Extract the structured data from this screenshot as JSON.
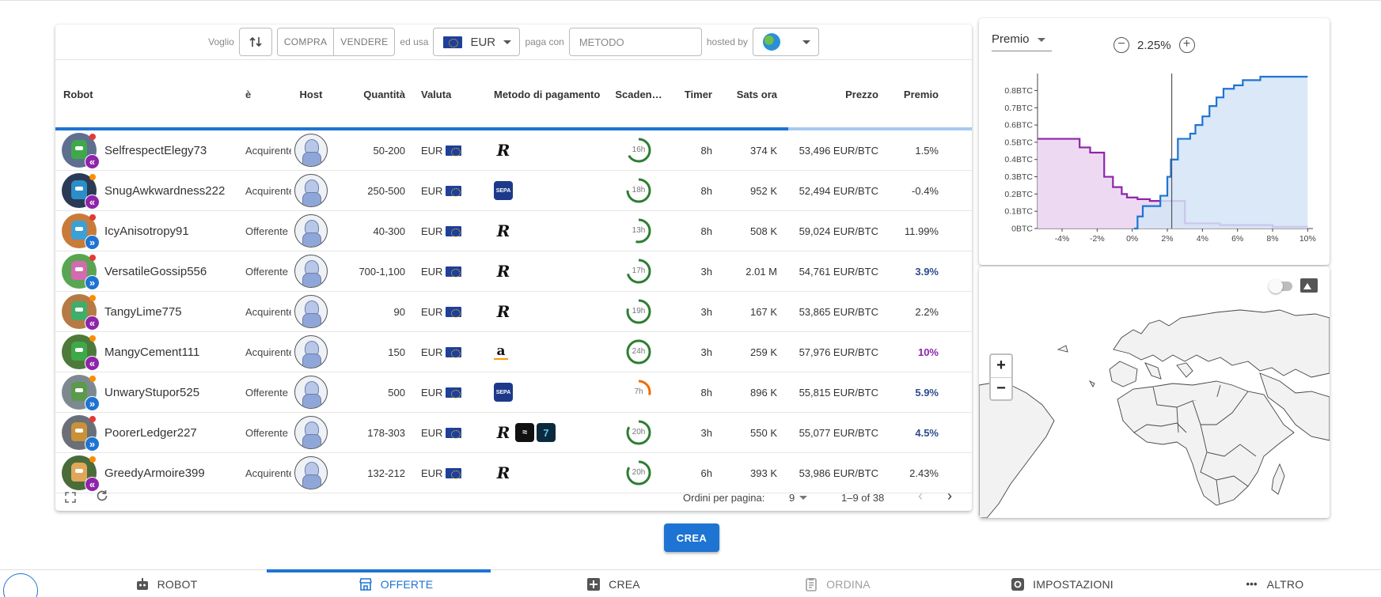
{
  "filter": {
    "voglio": "Voglio",
    "compra": "COMPRA",
    "vendere": "VENDERE",
    "ed_usa": "ed usa",
    "currency": "EUR",
    "paga_con": "paga con",
    "method_placeholder": "METODO",
    "hosted_by": "hosted by"
  },
  "table": {
    "headers": [
      "Robot",
      "è",
      "Host",
      "Quantità",
      "Valuta",
      "Metodo di pagamento",
      "Scaden…",
      "Timer",
      "Sats ora",
      "Prezzo",
      "Premio"
    ],
    "loading_progress": 0.8,
    "rows": [
      {
        "nick": "SelfrespectElegy73",
        "is": "Acquirente",
        "side": "buy",
        "status": "#e53935",
        "avatar": "#5f6f8f",
        "head": "#3fa84a",
        "qty": "50-200",
        "cur": "EUR",
        "methods": [
          "revolut"
        ],
        "exp": "16h",
        "exp_frac": 0.67,
        "exp_color": "#2e7d32",
        "timer": "8h",
        "sats": "374 K",
        "price": "53,496 EUR/BTC",
        "premium": "1.5%",
        "prem_style": "normal"
      },
      {
        "nick": "SnugAwkwardness222",
        "is": "Acquirente",
        "side": "buy",
        "status": "#fb8c00",
        "avatar": "#2b3a55",
        "head": "#2a8fc9",
        "qty": "250-500",
        "cur": "EUR",
        "methods": [
          "sepa"
        ],
        "exp": "18h",
        "exp_frac": 0.75,
        "exp_color": "#2e7d32",
        "timer": "8h",
        "sats": "952 K",
        "price": "52,494 EUR/BTC",
        "premium": "-0.4%",
        "prem_style": "normal"
      },
      {
        "nick": "IcyAnisotropy91",
        "is": "Offerente",
        "side": "sell",
        "status": "#e53935",
        "avatar": "#c97b3a",
        "head": "#3aa0d8",
        "qty": "40-300",
        "cur": "EUR",
        "methods": [
          "revolut"
        ],
        "exp": "13h",
        "exp_frac": 0.54,
        "exp_color": "#2e7d32",
        "timer": "8h",
        "sats": "508 K",
        "price": "59,024 EUR/BTC",
        "premium": "11.99%",
        "prem_style": "normal"
      },
      {
        "nick": "VersatileGossip556",
        "is": "Offerente",
        "side": "sell",
        "status": "#e53935",
        "avatar": "#5aa552",
        "head": "#d46bb0",
        "qty": "700-1,100",
        "cur": "EUR",
        "methods": [
          "revolut"
        ],
        "exp": "17h",
        "exp_frac": 0.71,
        "exp_color": "#2e7d32",
        "timer": "3h",
        "sats": "2.01 M",
        "price": "54,761 EUR/BTC",
        "premium": "3.9%",
        "prem_style": "sell"
      },
      {
        "nick": "TangyLime775",
        "is": "Acquirente",
        "side": "buy",
        "status": "#fb8c00",
        "avatar": "#b57a45",
        "head": "#3fae6a",
        "qty": "90",
        "cur": "EUR",
        "methods": [
          "revolut"
        ],
        "exp": "19h",
        "exp_frac": 0.79,
        "exp_color": "#2e7d32",
        "timer": "3h",
        "sats": "167 K",
        "price": "53,865 EUR/BTC",
        "premium": "2.2%",
        "prem_style": "normal"
      },
      {
        "nick": "MangyCement111",
        "is": "Acquirente",
        "side": "buy",
        "status": "#fb8c00",
        "avatar": "#4d7a3a",
        "head": "#3fa84a",
        "qty": "150",
        "cur": "EUR",
        "methods": [
          "amazon"
        ],
        "exp": "24h",
        "exp_frac": 1.0,
        "exp_color": "#2e7d32",
        "timer": "3h",
        "sats": "259 K",
        "price": "57,976 EUR/BTC",
        "premium": "10%",
        "prem_style": "buy"
      },
      {
        "nick": "UnwaryStupor525",
        "is": "Offerente",
        "side": "sell",
        "status": "#fb8c00",
        "avatar": "#7c8a8f",
        "head": "#5a9a4a",
        "qty": "500",
        "cur": "EUR",
        "methods": [
          "sepa"
        ],
        "exp": "7h",
        "exp_frac": 0.29,
        "exp_color": "#ef6c00",
        "timer": "8h",
        "sats": "896 K",
        "price": "55,815 EUR/BTC",
        "premium": "5.9%",
        "prem_style": "sell"
      },
      {
        "nick": "PoorerLedger227",
        "is": "Offerente",
        "side": "sell",
        "status": "#e53935",
        "avatar": "#6a6f78",
        "head": "#c9913a",
        "qty": "178-303",
        "cur": "EUR",
        "methods": [
          "revolut",
          "dark",
          "teal"
        ],
        "exp": "20h",
        "exp_frac": 0.83,
        "exp_color": "#2e7d32",
        "timer": "3h",
        "sats": "550 K",
        "price": "55,077 EUR/BTC",
        "premium": "4.5%",
        "prem_style": "sell"
      },
      {
        "nick": "GreedyArmoire399",
        "is": "Acquirente",
        "side": "buy",
        "status": "#fb8c00",
        "avatar": "#4a6b3a",
        "head": "#e0a65a",
        "qty": "132-212",
        "cur": "EUR",
        "methods": [
          "revolut"
        ],
        "exp": "20h",
        "exp_frac": 0.83,
        "exp_color": "#2e7d32",
        "timer": "6h",
        "sats": "393 K",
        "price": "53,986 EUR/BTC",
        "premium": "2.43%",
        "prem_style": "normal"
      }
    ],
    "method_glyphs": {
      "revolut": "R",
      "sepa": "SEPA",
      "amazon": "a",
      "dark": "≈",
      "teal": "7"
    },
    "footer": {
      "rows_per_page_label": "Ordini per pagina:",
      "rows_per_page": "9",
      "range": "1–9 of 38"
    }
  },
  "depth_chart": {
    "selector": "Premio",
    "zoom_value": "2.25%"
  },
  "chart_data": {
    "type": "area",
    "xlabel": "",
    "ylabel": "",
    "x_ticks": [
      "-4%",
      "-2%",
      "0%",
      "2%",
      "4%",
      "6%",
      "8%",
      "10%"
    ],
    "y_ticks": [
      "0BTC",
      "0.1BTC",
      "0.2BTC",
      "0.3BTC",
      "0.4BTC",
      "0.5BTC",
      "0.6BTC",
      "0.7BTC",
      "0.8BTC"
    ],
    "xlim": [
      -5.4,
      10.3
    ],
    "ylim": [
      0,
      0.88
    ],
    "center_line": 2.25,
    "series": [
      {
        "color": "#8e24aa",
        "fill": "#ead3f0",
        "x": [
          -5.4,
          -3.0,
          -3.0,
          -2.4,
          -2.4,
          -1.6,
          -1.6,
          -1.1,
          -1.1,
          -0.6,
          -0.6,
          -0.3,
          -0.3,
          0.3,
          0.3,
          1.0,
          1.0,
          3.0,
          3.0,
          5.0,
          5.0,
          8.0,
          8.0,
          10.0
        ],
        "y": [
          0.52,
          0.52,
          0.47,
          0.47,
          0.44,
          0.44,
          0.3,
          0.3,
          0.24,
          0.24,
          0.2,
          0.2,
          0.18,
          0.18,
          0.17,
          0.17,
          0.16,
          0.16,
          0.03,
          0.03,
          0.02,
          0.02,
          0.01,
          0.01
        ]
      },
      {
        "color": "#1e74d2",
        "fill": "#d3e4f7",
        "x": [
          0.1,
          0.3,
          0.3,
          0.6,
          0.6,
          1.6,
          1.6,
          2.0,
          2.0,
          2.2,
          2.2,
          2.6,
          2.6,
          3.3,
          3.3,
          3.6,
          3.6,
          4.0,
          4.0,
          4.4,
          4.4,
          4.8,
          4.8,
          5.2,
          5.2,
          5.8,
          5.8,
          6.3,
          6.3,
          7.3,
          7.3,
          8.0,
          8.0,
          10.0
        ],
        "y": [
          0.0,
          0.0,
          0.07,
          0.07,
          0.13,
          0.13,
          0.19,
          0.19,
          0.3,
          0.3,
          0.4,
          0.4,
          0.52,
          0.52,
          0.55,
          0.55,
          0.6,
          0.6,
          0.65,
          0.65,
          0.71,
          0.71,
          0.76,
          0.76,
          0.81,
          0.81,
          0.83,
          0.83,
          0.86,
          0.86,
          0.88,
          0.88,
          0.88,
          0.88
        ]
      }
    ]
  },
  "map": {
    "zoom_in": "+",
    "zoom_out": "−"
  },
  "crea_button": "CREA",
  "nav": {
    "robot": "ROBOT",
    "offerte": "OFFERTE",
    "crea": "CREA",
    "ordina": "ORDINA",
    "impostazioni": "IMPOSTAZIONI",
    "altro": "ALTRO"
  }
}
